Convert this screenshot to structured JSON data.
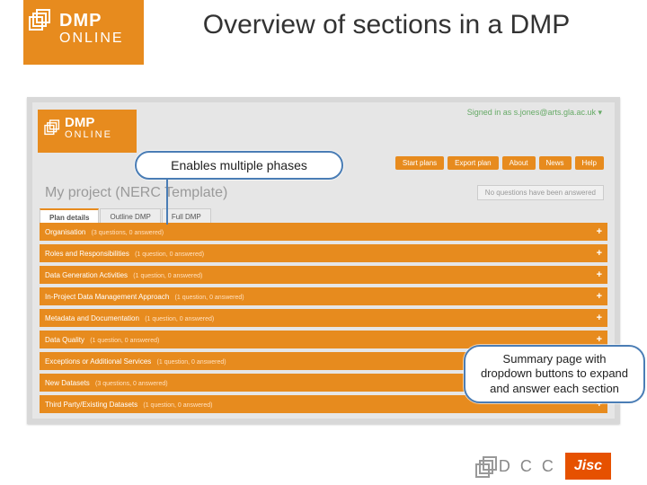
{
  "title": "Overview of sections in a DMP",
  "logo": {
    "dmp": "DMP",
    "online": "ONLINE"
  },
  "callout_phases": "Enables multiple phases",
  "callout_summary": "Summary page with dropdown buttons to expand and answer each section",
  "app": {
    "signed_in": "Signed in as s.jones@arts.gla.ac.uk ▾",
    "nav": [
      "Start plans",
      "Export plan",
      "About",
      "News",
      "Help"
    ],
    "project_heading": "My project (NERC Template)",
    "status": "No questions have been answered",
    "tabs": [
      {
        "label": "Plan details",
        "active": true
      },
      {
        "label": "Outline DMP",
        "active": false
      },
      {
        "label": "Full DMP",
        "active": false
      }
    ],
    "sections": [
      {
        "label": "Organisation",
        "meta": "(3 questions, 0 answered)"
      },
      {
        "label": "Roles and Responsibilities",
        "meta": "(1 question, 0 answered)"
      },
      {
        "label": "Data Generation Activities",
        "meta": "(1 question, 0 answered)"
      },
      {
        "label": "In-Project Data Management Approach",
        "meta": "(1 question, 0 answered)"
      },
      {
        "label": "Metadata and Documentation",
        "meta": "(1 question, 0 answered)"
      },
      {
        "label": "Data Quality",
        "meta": "(1 question, 0 answered)"
      },
      {
        "label": "Exceptions or Additional Services",
        "meta": "(1 question, 0 answered)"
      },
      {
        "label": "New Datasets",
        "meta": "(3 questions, 0 answered)"
      },
      {
        "label": "Third Party/Existing Datasets",
        "meta": "(1 question, 0 answered)"
      }
    ]
  },
  "footer": {
    "dcc": "D C C",
    "jisc": "Jisc"
  }
}
